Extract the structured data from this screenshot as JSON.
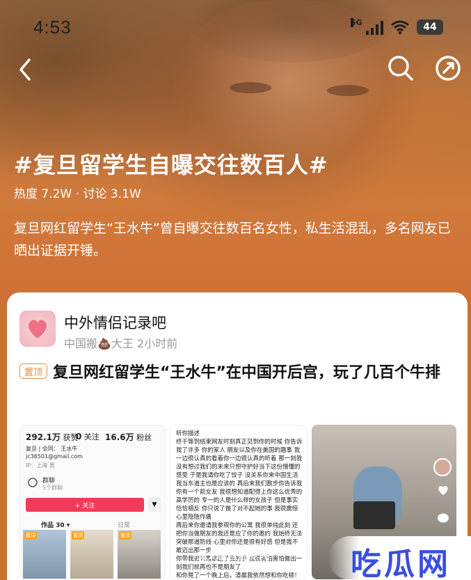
{
  "status_bar": {
    "time": "4:53",
    "network": "5G",
    "battery": "44"
  },
  "topic": {
    "title": "#复旦留学生自曝交往数百人#",
    "stats": "热度 7.2W · 讨论 3.1W",
    "description": "复旦网红留学生“王水牛”曾自曝交往数百名女性，私生活混乱，多名网友已晒出证据开锤。"
  },
  "post": {
    "group_name": "中外情侣记录吧",
    "meta": "中国搬💩大王 2小时前",
    "tag": "置顶",
    "title": "复旦网红留学生“王水牛”在中国开后宫，玩了几百个牛排"
  },
  "profile_shot": {
    "likes": "292.1万",
    "likes_label": "获赞",
    "following": "0",
    "following_label": "关注",
    "fans": "16.6万",
    "fans_label": "粉丝",
    "line1": "复旦 | 全同：  王水牛",
    "line2": "jc36501@gmail.com",
    "line3": "IP：上海  男",
    "group_label": "群聊",
    "group_sub": "5个群聊",
    "follow_label": "+ 关注",
    "tab_works": "作品 30 ▾",
    "tab_daily": "日常",
    "pin1": "置顶",
    "pin2": "置顶",
    "pin3": "置顶"
  },
  "chat_text": "听你描述\n终于等到结束网友时刻真正见到你的时候 你告诉我了许多 你的家人 朋友以及你在美国的趣事 我一边很认真的看着你一边很认真的听着 那一刻我没有想过我们的未来只想守护好当下这份懵懂的感受 于是我请你吃了饺子 没关系你来中国生活我当东道主也是应该的 再后来我们散步你告诉我你有一个前女友 我很想知道配得上你这么优秀的 高学历的 专一的人是什么样的女孩子 但是事实恰恰相反 你只说了做了对不起她的事 我很震惊心里隐隐作痛\n再后来你邀请我参观你的公寓 我很单纯此刻 还把你当做朋友的我还是应了你的邀约 我始终无法突破那道防线 心里对你还是很有好感 但是我不敢迈出那一步\n你带我进公寓拿起了我的手 我很害怕害怕做出一刻我们就再也不是朋友了\n和你晃了一个晚上后，清晨我依然想和你吃顿！",
  "watermark": {
    "source": "@大象直播新闻",
    "logo": "吃瓜网"
  },
  "colors": {
    "accent": "#f23b5a",
    "tag_orange": "#f08a3c",
    "hero": "#cf6f33"
  }
}
